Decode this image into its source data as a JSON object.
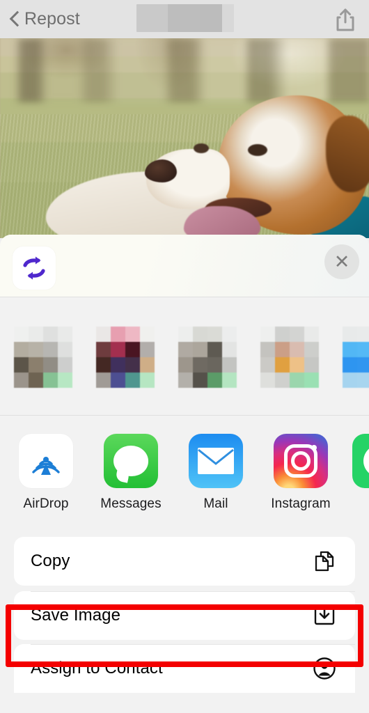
{
  "navbar": {
    "back_label": "Repost",
    "back_icon": "chevron-left-icon",
    "title_redacted": "",
    "share_icon": "share-upload-icon"
  },
  "photo": {
    "alt": "brown and white dog lying in grass with tongue out",
    "icon": "photo-preview"
  },
  "share_sheet": {
    "app_icon": "repost-loop-icon",
    "app_icon_color": "#4f28cd",
    "close_icon": "close-x-icon",
    "close_label": "✕",
    "suggestions": [
      {
        "name": "suggestion-1",
        "redacted": true
      },
      {
        "name": "suggestion-2",
        "redacted": true
      },
      {
        "name": "suggestion-3",
        "redacted": true
      },
      {
        "name": "suggestion-4",
        "redacted": true
      },
      {
        "name": "suggestion-5",
        "redacted": true
      }
    ],
    "apps": [
      {
        "label": "AirDrop",
        "icon": "airdrop-icon",
        "color": "#0a84ff"
      },
      {
        "label": "Messages",
        "icon": "messages-icon",
        "color": "#2bbf35"
      },
      {
        "label": "Mail",
        "icon": "mail-icon",
        "color": "#1d8cf0"
      },
      {
        "label": "Instagram",
        "icon": "instagram-icon",
        "color": "#d92e7f"
      },
      {
        "label": "",
        "icon": "whatsapp-icon",
        "color": "#25d366"
      }
    ],
    "actions": [
      {
        "label": "Copy",
        "icon": "copy-documents-icon",
        "highlighted": false
      },
      {
        "label": "Save Image",
        "icon": "download-tray-icon",
        "highlighted": true
      },
      {
        "label": "Assign to Contact",
        "icon": "person-circle-icon",
        "highlighted": false
      }
    ]
  },
  "highlight": {
    "color": "#f40000",
    "target": "Save Image"
  }
}
